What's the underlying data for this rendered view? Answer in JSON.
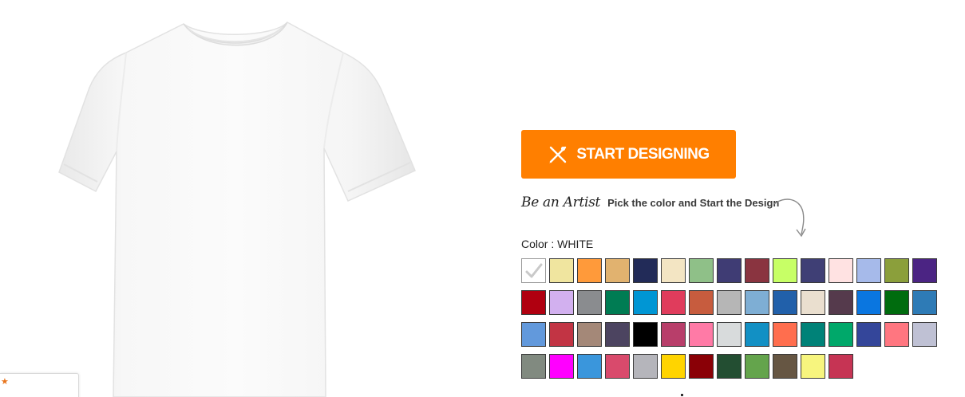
{
  "product": {
    "image_icon": "white-tshirt",
    "color_name": "WHITE"
  },
  "review_widget": {
    "star_glyph": "★"
  },
  "designer": {
    "start_button_label": "START DESIGNING",
    "start_button_icon": "pencil-ruler-icon",
    "tagline_script": "Be an Artist",
    "tagline_hint": "Pick the color and Start the Design",
    "color_label_prefix": "Color : ",
    "accent_color": "#ff7f00"
  },
  "swatches": [
    {
      "color": "#ffffff",
      "selected": true
    },
    {
      "color": "#f0e59f",
      "selected": false
    },
    {
      "color": "#ff9a3a",
      "selected": false
    },
    {
      "color": "#e1b26f",
      "selected": false
    },
    {
      "color": "#222b58",
      "selected": false
    },
    {
      "color": "#f3e5c3",
      "selected": false
    },
    {
      "color": "#8fc088",
      "selected": false
    },
    {
      "color": "#3f3c74",
      "selected": false
    },
    {
      "color": "#8a3440",
      "selected": false
    },
    {
      "color": "#c7ff66",
      "selected": false
    },
    {
      "color": "#3f3f75",
      "selected": false
    },
    {
      "color": "#ffe2e2",
      "selected": false
    },
    {
      "color": "#a6baea",
      "selected": false
    },
    {
      "color": "#8b9f3b",
      "selected": false
    },
    {
      "color": "#4b2483",
      "selected": false
    },
    {
      "color": "#b00010",
      "selected": false
    },
    {
      "color": "#d2b0ef",
      "selected": false
    },
    {
      "color": "#8a8c8f",
      "selected": false
    },
    {
      "color": "#007c53",
      "selected": false
    },
    {
      "color": "#0096d4",
      "selected": false
    },
    {
      "color": "#e03c5c",
      "selected": false
    },
    {
      "color": "#c75c3e",
      "selected": false
    },
    {
      "color": "#b6b6b6",
      "selected": false
    },
    {
      "color": "#7eaed4",
      "selected": false
    },
    {
      "color": "#2160aa",
      "selected": false
    },
    {
      "color": "#eadfcf",
      "selected": false
    },
    {
      "color": "#553a4c",
      "selected": false
    },
    {
      "color": "#0a76e0",
      "selected": false
    },
    {
      "color": "#006c0e",
      "selected": false
    },
    {
      "color": "#2e7bb6",
      "selected": false
    },
    {
      "color": "#6299dc",
      "selected": false
    },
    {
      "color": "#c23444",
      "selected": false
    },
    {
      "color": "#a48878",
      "selected": false
    },
    {
      "color": "#4c4460",
      "selected": false
    },
    {
      "color": "#000000",
      "selected": false
    },
    {
      "color": "#b83e6a",
      "selected": false
    },
    {
      "color": "#ff7aa6",
      "selected": false
    },
    {
      "color": "#d8dbdc",
      "selected": false
    },
    {
      "color": "#1290c4",
      "selected": false
    },
    {
      "color": "#ff6e4e",
      "selected": false
    },
    {
      "color": "#008278",
      "selected": false
    },
    {
      "color": "#00a86a",
      "selected": false
    },
    {
      "color": "#34469a",
      "selected": false
    },
    {
      "color": "#ff7680",
      "selected": false
    },
    {
      "color": "#bfc1d4",
      "selected": false
    },
    {
      "color": "#818a80",
      "selected": false
    },
    {
      "color": "#ff00ff",
      "selected": false
    },
    {
      "color": "#3a96dc",
      "selected": false
    },
    {
      "color": "#d94a6c",
      "selected": false
    },
    {
      "color": "#b5b5bb",
      "selected": false
    },
    {
      "color": "#ffd400",
      "selected": false
    },
    {
      "color": "#8a0006",
      "selected": false
    },
    {
      "color": "#234e32",
      "selected": false
    },
    {
      "color": "#64a44c",
      "selected": false
    },
    {
      "color": "#665643",
      "selected": false
    },
    {
      "color": "#f7f57e",
      "selected": false
    },
    {
      "color": "#c63454",
      "selected": false
    }
  ]
}
